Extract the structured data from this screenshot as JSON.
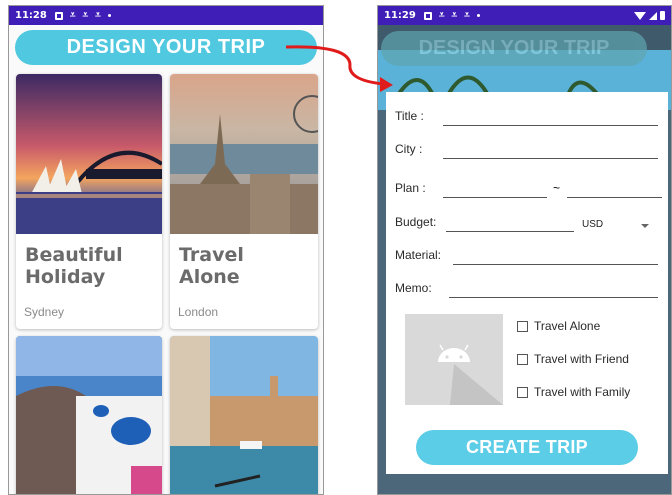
{
  "left_phone": {
    "status_time": "11:28",
    "title": "DESIGN YOUR TRIP",
    "cards": [
      {
        "title": "Beautiful\nHoliday",
        "subtitle": "Sydney"
      },
      {
        "title": "Travel\nAlone",
        "subtitle": "London"
      },
      {
        "title": "",
        "subtitle": ""
      },
      {
        "title": "",
        "subtitle": ""
      }
    ]
  },
  "right_phone": {
    "status_time": "11:29",
    "bg_title": "DESIGN YOUR TRIP",
    "form": {
      "title_label": "Title :",
      "city_label": "City :",
      "plan_label": "Plan :",
      "plan_separator": "~",
      "budget_label": "Budget:",
      "currency": "USD",
      "material_label": "Material:",
      "memo_label": "Memo:",
      "options": [
        "Travel Alone",
        "Travel with Friend",
        "Travel with Family"
      ],
      "create_button": "CREATE TRIP"
    }
  },
  "colors": {
    "status_bar": "#3f1eb8",
    "accent": "#4fc8e0",
    "arrow": "#e01b1b"
  }
}
